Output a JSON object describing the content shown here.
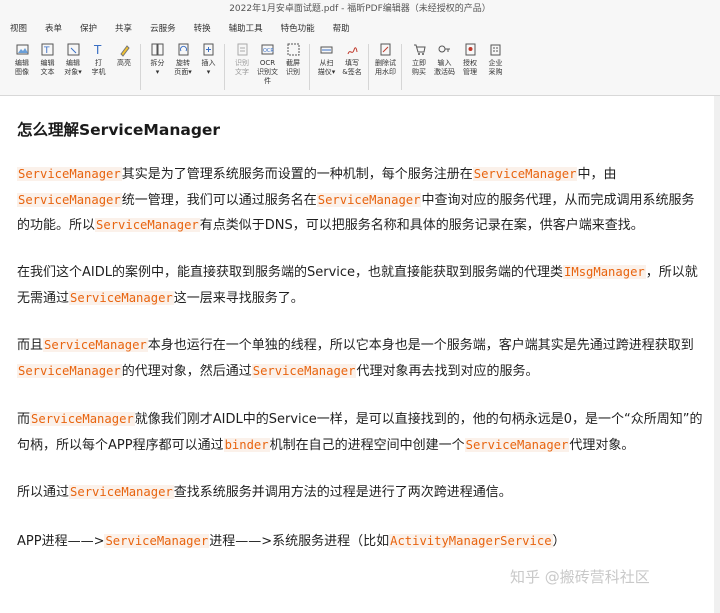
{
  "window": {
    "title": "2022年1月安卓面试题.pdf - 福昕PDF编辑器（未经授权的产品）"
  },
  "menu": [
    "视图",
    "表单",
    "保护",
    "共享",
    "云服务",
    "转换",
    "辅助工具",
    "特色功能",
    "帮助"
  ],
  "toolbar": [
    {
      "icon": "image-icon",
      "label": "编辑\n图像",
      "disabled": false
    },
    {
      "icon": "edit-text-icon",
      "label": "编辑\n文本",
      "disabled": false
    },
    {
      "icon": "edit-object-icon",
      "label": "编辑\n对象▾",
      "disabled": false
    },
    {
      "icon": "typewriter-icon",
      "label": "打\n字机",
      "disabled": false
    },
    {
      "icon": "highlight-icon",
      "label": "高亮",
      "disabled": false
    },
    {
      "icon": "split-icon",
      "label": "拆分\n▾",
      "disabled": false
    },
    {
      "icon": "rotate-icon",
      "label": "旋转\n页面▾",
      "disabled": false
    },
    {
      "icon": "insert-icon",
      "label": "插入\n▾",
      "disabled": false
    },
    {
      "icon": "recognize-icon",
      "label": "识别\n文字",
      "disabled": true
    },
    {
      "icon": "ocr-icon",
      "label": "OCR\n识别文件",
      "disabled": false
    },
    {
      "icon": "screenshot-icon",
      "label": "截屏\n识别",
      "disabled": false
    },
    {
      "icon": "scan-icon",
      "label": "从扫\n描仪▾",
      "disabled": false
    },
    {
      "icon": "sign-icon",
      "label": "填写\n&签名",
      "disabled": false
    },
    {
      "icon": "watermark-icon",
      "label": "删除试\n用水印",
      "disabled": false
    },
    {
      "icon": "cart-icon",
      "label": "立即\n购买",
      "disabled": false
    },
    {
      "icon": "key-icon",
      "label": "输入\n激活码",
      "disabled": false
    },
    {
      "icon": "license-icon",
      "label": "授权\n管理",
      "disabled": false
    },
    {
      "icon": "enterprise-icon",
      "label": "企业\n采购",
      "disabled": false
    }
  ],
  "document": {
    "heading": "怎么理解ServiceManager",
    "paragraphs": [
      [
        {
          "t": "ServiceManager",
          "c": true
        },
        {
          "t": "其实是为了管理系统服务而设置的一种机制，每个服务注册在"
        },
        {
          "t": "ServiceManager",
          "c": true
        },
        {
          "t": "中，由"
        },
        {
          "t": "ServiceManager",
          "c": true
        },
        {
          "t": "统一管理，我们可以通过服务名在"
        },
        {
          "t": "ServiceManager",
          "c": true
        },
        {
          "t": "中查询对应的服务代理，从而完成调用系统服务的功能。所以"
        },
        {
          "t": "ServiceManager",
          "c": true
        },
        {
          "t": "有点类似于DNS，可以把服务名称和具体的服务记录在案，供客户端来查找。"
        }
      ],
      [
        {
          "t": "在我们这个AIDL的案例中，能直接获取到服务端的Service，也就直接能获取到服务端的代理类"
        },
        {
          "t": "IMsgManager",
          "c": true
        },
        {
          "t": "，所以就无需通过"
        },
        {
          "t": "ServiceManager",
          "c": true
        },
        {
          "t": "这一层来寻找服务了。"
        }
      ],
      [
        {
          "t": "而且"
        },
        {
          "t": "ServiceManager",
          "c": true
        },
        {
          "t": "本身也运行在一个单独的线程，所以它本身也是一个服务端，客户端其实是先通过跨进程获取到"
        },
        {
          "t": "ServiceManager",
          "c": true
        },
        {
          "t": "的代理对象，然后通过"
        },
        {
          "t": "ServiceManager",
          "c": true
        },
        {
          "t": "代理对象再去找到对应的服务。"
        }
      ],
      [
        {
          "t": "而"
        },
        {
          "t": "ServiceManager",
          "c": true
        },
        {
          "t": "就像我们刚才AIDL中的Service一样，是可以直接找到的，他的句柄永远是0，是一个“众所周知”的句柄，所以每个APP程序都可以通过"
        },
        {
          "t": "binder",
          "c": true
        },
        {
          "t": "机制在自己的进程空间中创建一个"
        },
        {
          "t": "ServiceManager",
          "c": true
        },
        {
          "t": "代理对象。"
        }
      ],
      [
        {
          "t": "所以通过"
        },
        {
          "t": "ServiceManager",
          "c": true
        },
        {
          "t": "查找系统服务并调用方法的过程是进行了两次跨进程通信。"
        }
      ],
      [
        {
          "t": "APP进程——>"
        },
        {
          "t": "ServiceManager",
          "c": true
        },
        {
          "t": "进程——>系统服务进程（比如"
        },
        {
          "t": "ActivityManagerService",
          "c": true
        },
        {
          "t": "）"
        }
      ]
    ]
  },
  "watermark": {
    "text": "知乎 @搬砖营科社区"
  },
  "colors": {
    "code": "#e8640f",
    "code_bg": "#fbf1ea",
    "toolbar_bg": "#f7f7f7"
  }
}
